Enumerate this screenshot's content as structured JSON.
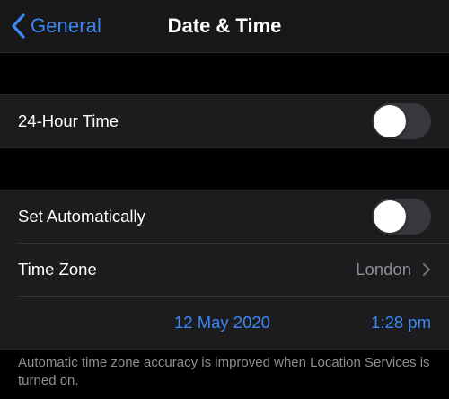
{
  "navbar": {
    "back_label": "General",
    "title": "Date & Time"
  },
  "colors": {
    "accent": "#3b87f5",
    "background": "#000000",
    "cell": "#1c1c1e",
    "secondary_text": "#8d8d93",
    "toggle_off": "#39393d"
  },
  "settings": {
    "hour24": {
      "label": "24-Hour Time",
      "enabled": false
    },
    "set_automatically": {
      "label": "Set Automatically",
      "enabled": false
    },
    "time_zone": {
      "label": "Time Zone",
      "value": "London"
    },
    "date": "12 May 2020",
    "time": "1:28 pm"
  },
  "footer": {
    "note": "Automatic time zone accuracy is improved when Location Services is turned on."
  },
  "icons": {
    "back": "chevron-left-icon",
    "disclosure": "chevron-right-icon"
  }
}
